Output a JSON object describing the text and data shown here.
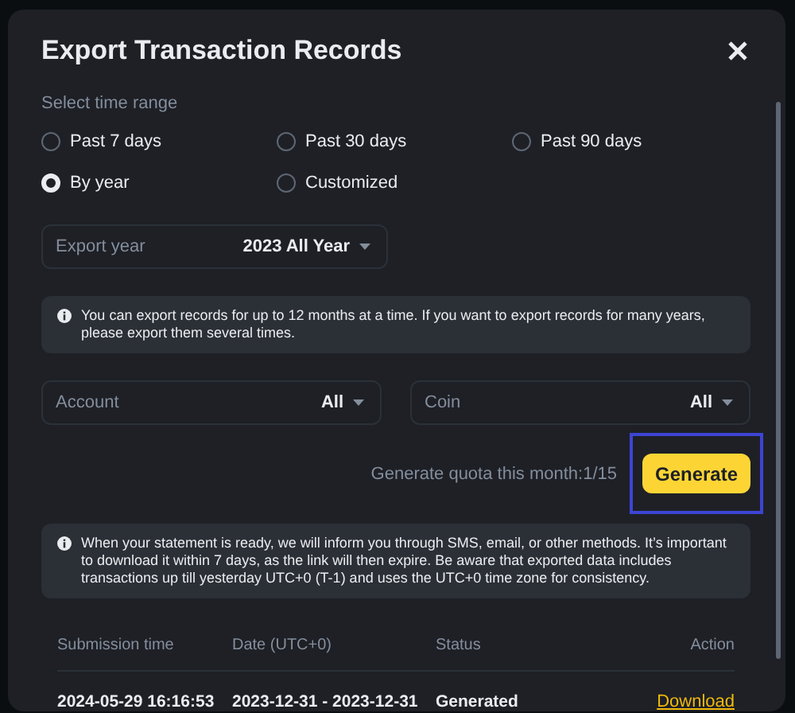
{
  "dialog": {
    "title": "Export Transaction Records",
    "time_range_label": "Select time range",
    "options": [
      {
        "label": "Past 7 days",
        "selected": false
      },
      {
        "label": "Past 30 days",
        "selected": false
      },
      {
        "label": "Past 90 days",
        "selected": false
      },
      {
        "label": "By year",
        "selected": true
      },
      {
        "label": "Customized",
        "selected": false
      }
    ],
    "export_year": {
      "label": "Export year",
      "value": "2023 All Year"
    },
    "notice": "You can export records for up to 12 months at a time. If you want to export records for many years, please export them several times.",
    "filters": [
      {
        "label": "Account",
        "value": "All"
      },
      {
        "label": "Coin",
        "value": "All"
      }
    ],
    "quota": "Generate quota this month:1/15",
    "generate": "Generate",
    "info": "When your statement is ready, we will inform you through SMS, email, or other methods. It’s important to download it within 7 days, as the link will then expire. Be aware that exported data includes transactions up till yesterday UTC+0 (T-1) and uses the UTC+0 time zone for consistency.",
    "table": {
      "columns": [
        "Submission time",
        "Date (UTC+0)",
        "Status",
        "Action"
      ],
      "rows": [
        {
          "submission_time": "2024-05-29 16:16:53",
          "date": "2023-12-31 - 2023-12-31",
          "status": "Generated",
          "action": "Download"
        }
      ]
    }
  }
}
